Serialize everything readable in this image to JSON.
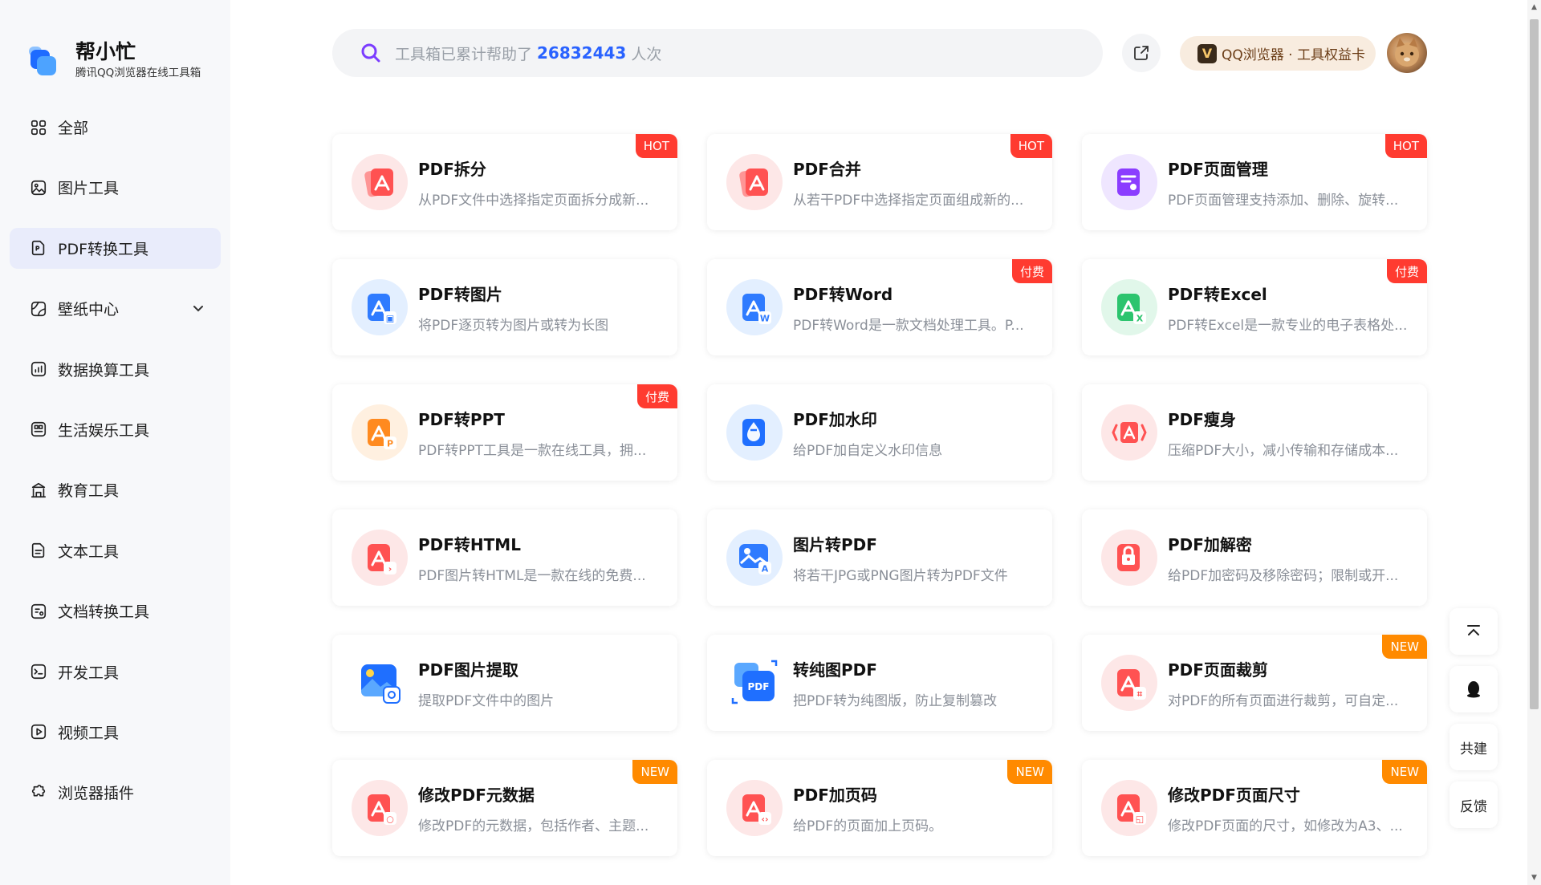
{
  "brand": {
    "name": "帮小忙",
    "subtitle": "腾讯QQ浏览器在线工具箱"
  },
  "sidebar": {
    "items": [
      {
        "label": "全部",
        "icon": "grid-icon",
        "active": false
      },
      {
        "label": "图片工具",
        "icon": "image-icon",
        "active": false
      },
      {
        "label": "PDF转换工具",
        "icon": "pdf-icon",
        "active": true
      },
      {
        "label": "壁纸中心",
        "icon": "wallpaper-icon",
        "active": false,
        "expandable": true
      },
      {
        "label": "数据换算工具",
        "icon": "chart-icon",
        "active": false
      },
      {
        "label": "生活娱乐工具",
        "icon": "gamepad-icon",
        "active": false
      },
      {
        "label": "教育工具",
        "icon": "school-icon",
        "active": false
      },
      {
        "label": "文本工具",
        "icon": "text-icon",
        "active": false
      },
      {
        "label": "文档转换工具",
        "icon": "document-icon",
        "active": false
      },
      {
        "label": "开发工具",
        "icon": "terminal-icon",
        "active": false
      },
      {
        "label": "视频工具",
        "icon": "video-icon",
        "active": false
      },
      {
        "label": "浏览器插件",
        "icon": "puzzle-icon",
        "active": false
      }
    ]
  },
  "search": {
    "prefix": "工具箱已累计帮助了",
    "count": "26832443",
    "suffix": "人次"
  },
  "header": {
    "vip_label": "QQ浏览器 · 工具权益卡",
    "vip_icon_letter": "V"
  },
  "tools": [
    {
      "title": "PDF拆分",
      "desc": "从PDF文件中选择指定页面拆分成新...",
      "badge": "HOT",
      "badge_type": "hot",
      "icon": "pdf-split-icon",
      "color": "#ff5252",
      "bg": "#fde7e7"
    },
    {
      "title": "PDF合并",
      "desc": "从若干PDF中选择指定页面组成新的...",
      "badge": "HOT",
      "badge_type": "hot",
      "icon": "pdf-merge-icon",
      "color": "#ff5252",
      "bg": "#fde7e7"
    },
    {
      "title": "PDF页面管理",
      "desc": "PDF页面管理支持添加、删除、旋转...",
      "badge": "HOT",
      "badge_type": "hot",
      "icon": "pdf-page-manage-icon",
      "color": "#8b3dff",
      "bg": "#efe6ff"
    },
    {
      "title": "PDF转图片",
      "desc": "将PDF逐页转为图片或转为长图",
      "badge": "",
      "badge_type": "",
      "icon": "pdf-to-image-icon",
      "color": "#2f7bff",
      "bg": "#e3efff"
    },
    {
      "title": "PDF转Word",
      "desc": "PDF转Word是一款文档处理工具。P...",
      "badge": "付费",
      "badge_type": "paid",
      "icon": "pdf-to-word-icon",
      "color": "#2f7bff",
      "bg": "#e3efff"
    },
    {
      "title": "PDF转Excel",
      "desc": "PDF转Excel是一款专业的电子表格处...",
      "badge": "付费",
      "badge_type": "paid",
      "icon": "pdf-to-excel-icon",
      "color": "#2cc46e",
      "bg": "#e1f7ea"
    },
    {
      "title": "PDF转PPT",
      "desc": "PDF转PPT工具是一款在线工具，拥...",
      "badge": "付费",
      "badge_type": "paid",
      "icon": "pdf-to-ppt-icon",
      "color": "#ff8a1f",
      "bg": "#fff0e0"
    },
    {
      "title": "PDF加水印",
      "desc": "给PDF加自定义水印信息",
      "badge": "",
      "badge_type": "",
      "icon": "pdf-watermark-icon",
      "color": "#1f6fff",
      "bg": "#e3efff"
    },
    {
      "title": "PDF瘦身",
      "desc": "压缩PDF大小，减小传输和存储成本...",
      "badge": "",
      "badge_type": "",
      "icon": "pdf-compress-icon",
      "color": "#ff5252",
      "bg": "#fde7e7"
    },
    {
      "title": "PDF转HTML",
      "desc": "PDF图片转HTML是一款在线的免费...",
      "badge": "",
      "badge_type": "",
      "icon": "pdf-to-html-icon",
      "color": "#ff5252",
      "bg": "#fde7e7"
    },
    {
      "title": "图片转PDF",
      "desc": "将若干JPG或PNG图片转为PDF文件",
      "badge": "",
      "badge_type": "",
      "icon": "image-to-pdf-icon",
      "color": "#2f7bff",
      "bg": "#e3efff"
    },
    {
      "title": "PDF加解密",
      "desc": "给PDF加密码及移除密码；限制或开...",
      "badge": "",
      "badge_type": "",
      "icon": "pdf-lock-icon",
      "color": "#ff5252",
      "bg": "#fde7e7"
    },
    {
      "title": "PDF图片提取",
      "desc": "提取PDF文件中的图片",
      "badge": "",
      "badge_type": "",
      "icon": "pdf-image-extract-icon",
      "color": "#1f6fff",
      "bg": "#ffffff"
    },
    {
      "title": "转纯图PDF",
      "desc": "把PDF转为纯图版，防止复制篡改",
      "badge": "",
      "badge_type": "",
      "icon": "pure-image-pdf-icon",
      "color": "#1f6fff",
      "bg": "#ffffff"
    },
    {
      "title": "PDF页面裁剪",
      "desc": "对PDF的所有页面进行裁剪，可自定...",
      "badge": "NEW",
      "badge_type": "new",
      "icon": "pdf-crop-icon",
      "color": "#ff5252",
      "bg": "#fde7e7"
    },
    {
      "title": "修改PDF元数据",
      "desc": "修改PDF的元数据，包括作者、主题...",
      "badge": "NEW",
      "badge_type": "new",
      "icon": "pdf-metadata-icon",
      "color": "#ff5252",
      "bg": "#fde7e7"
    },
    {
      "title": "PDF加页码",
      "desc": "给PDF的页面加上页码。",
      "badge": "NEW",
      "badge_type": "new",
      "icon": "pdf-page-number-icon",
      "color": "#ff5252",
      "bg": "#fde7e7"
    },
    {
      "title": "修改PDF页面尺寸",
      "desc": "修改PDF页面的尺寸，如修改为A3、...",
      "badge": "NEW",
      "badge_type": "new",
      "icon": "pdf-page-size-icon",
      "color": "#ff5252",
      "bg": "#fde7e7"
    }
  ],
  "floating": {
    "cobuild": "共建",
    "feedback": "反馈"
  }
}
